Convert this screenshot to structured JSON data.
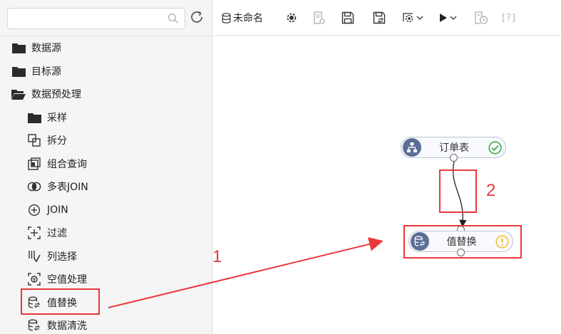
{
  "sidebar": {
    "search": {
      "value": "",
      "placeholder": ""
    },
    "tree": [
      {
        "label": "数据源",
        "icon": "folder-icon"
      },
      {
        "label": "目标源",
        "icon": "folder-icon"
      },
      {
        "label": "数据预处理",
        "icon": "folder-open-icon"
      },
      {
        "label": "采样",
        "icon": "folder-icon"
      },
      {
        "label": "拆分",
        "icon": "split-icon"
      },
      {
        "label": "组合查询",
        "icon": "combine-query-icon"
      },
      {
        "label": "多表JOIN",
        "icon": "multi-join-icon"
      },
      {
        "label": "JOIN",
        "icon": "join-icon"
      },
      {
        "label": "过滤",
        "icon": "filter-icon"
      },
      {
        "label": "列选择",
        "icon": "column-select-icon"
      },
      {
        "label": "空值处理",
        "icon": "null-handling-icon"
      },
      {
        "label": "值替换",
        "icon": "value-replace-icon"
      },
      {
        "label": "数据清洗",
        "icon": "data-clean-icon"
      }
    ]
  },
  "toolbar": {
    "name": "未命名",
    "help": "[?]",
    "icons": [
      "database-icon",
      "settings-icon",
      "report-icon",
      "save-icon",
      "save-as-icon",
      "config-dropdown-icon",
      "run-dropdown-icon",
      "history-icon",
      "help-icon"
    ]
  },
  "canvas": {
    "nodes": [
      {
        "label": "订单表",
        "icon": "table-source-icon",
        "status": "success"
      },
      {
        "label": "值替换",
        "icon": "value-replace-icon",
        "status": "warning"
      }
    ]
  },
  "annotations": {
    "step1": "1",
    "step2": "2"
  },
  "colors": {
    "annotation": "#e8383b",
    "node_icon_bg": "#5a6e96",
    "success": "#3fae49",
    "warning": "#f2c230"
  }
}
